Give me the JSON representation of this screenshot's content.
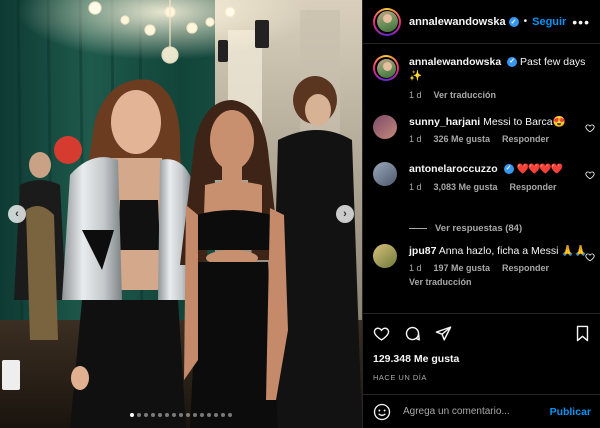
{
  "post": {
    "username": "annalewandowska",
    "follow_label": "Seguir",
    "more_label": "•••",
    "caption": "Past few days ✨",
    "caption_time": "1 d",
    "translate_label": "Ver traducción",
    "likes": "129.348 Me gusta",
    "posted": "HACE UN DÍA",
    "carousel_dots": 15,
    "carousel_active": 0
  },
  "comments": [
    {
      "username": "sunny_harjani",
      "text": "Messi to Barca😍",
      "time": "1 d",
      "likes": "326 Me gusta",
      "reply": "Responder",
      "verified": false
    },
    {
      "username": "antonelaroccuzzo",
      "text": "❤️❤️❤️❤️",
      "time": "1 d",
      "likes": "3,083 Me gusta",
      "reply": "Responder",
      "verified": true
    },
    {
      "username": "jpu87",
      "text": "Anna hazlo, ficha a Messi 🙏🙏",
      "time": "1 d",
      "likes": "197 Me gusta",
      "reply": "Responder",
      "translate": "Ver traducción",
      "verified": false
    }
  ],
  "view_replies": "Ver respuestas (84)",
  "add_comment": {
    "placeholder": "Agrega un comentario...",
    "publish": "Publicar"
  },
  "icons": {
    "like": "heart-icon",
    "comment": "comment-icon",
    "share": "share-icon",
    "save": "bookmark-icon",
    "emoji": "emoji-icon",
    "prev": "chevron-left-icon",
    "next": "chevron-right-icon"
  },
  "colors": {
    "accent": "#0095f6",
    "verified": "#3897f0",
    "heart_red": "#ff3040",
    "muted": "#a8a8a8"
  }
}
